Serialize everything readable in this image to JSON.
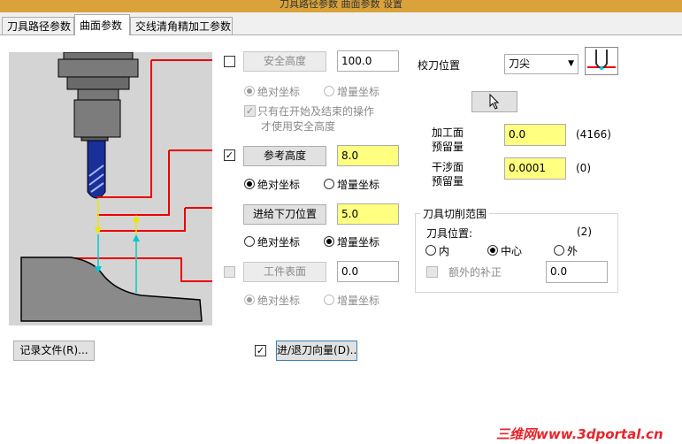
{
  "window": {
    "title": "刀具路径参数 曲面参数 设置"
  },
  "tabs": [
    {
      "label": "刀具路径参数",
      "active": false
    },
    {
      "label": "曲面参数",
      "active": true
    },
    {
      "label": "交线清角精加工参数",
      "active": false
    }
  ],
  "clearance": {
    "enabled": false,
    "button": "安全高度",
    "value": "100.0",
    "abs_label": "绝对坐标",
    "inc_label": "增量坐标",
    "mode": "absolute",
    "only_start_end_line1": "只有在开始及结束的操作",
    "only_start_end_line2": "才使用安全高度",
    "only_start_end_checked": true
  },
  "retract": {
    "enabled": true,
    "button": "参考高度",
    "value": "8.0",
    "abs_label": "绝对坐标",
    "inc_label": "增量坐标",
    "mode": "absolute"
  },
  "feed_plane": {
    "button": "进给下刀位置",
    "value": "5.0",
    "abs_label": "绝对坐标",
    "inc_label": "增量坐标",
    "mode": "incremental"
  },
  "top_of_stock": {
    "enabled": false,
    "button": "工件表面",
    "value": "0.0",
    "abs_label": "绝对坐标",
    "inc_label": "增量坐标",
    "mode": "absolute"
  },
  "tip_comp": {
    "label": "校刀位置",
    "selected": "刀尖"
  },
  "cursor_button": {
    "label": ""
  },
  "stock_to_leave": {
    "drive_label_line1": "加工面",
    "drive_label_line2": "预留量",
    "drive_value": "0.0",
    "drive_count": "(4166)",
    "check_label_line1": "干涉面",
    "check_label_line2": "预留量",
    "check_value": "0.0001",
    "check_count": "(0)"
  },
  "containment": {
    "title": "刀具切削范围",
    "position_label": "刀具位置:",
    "position_count": "(2)",
    "inside_label": "内",
    "center_label": "中心",
    "outside_label": "外",
    "selected": "center",
    "extra_comp_label": "额外的补正",
    "extra_comp_checked": false,
    "extra_comp_value": "0.0"
  },
  "bottom": {
    "record_file_button": "记录文件(R)...",
    "entry_exit_checked": true,
    "entry_exit_button": "进/退刀向量(D).."
  },
  "watermark": "三维网www.3dportal.cn",
  "colors": {
    "field_highlight": "#ffff80",
    "diagram_red": "#ee0000",
    "diagram_cyan": "#00c8d8",
    "diagram_yellow": "#e8e800",
    "tool_blue": "#1a2f9a"
  }
}
